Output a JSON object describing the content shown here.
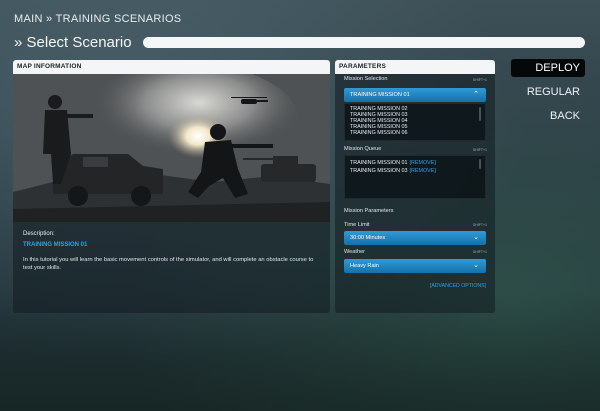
{
  "header": {
    "breadcrumb": "MAIN » TRAINING SCENARIOS",
    "title": "» Select Scenario"
  },
  "map_panel": {
    "header": "MAP INFORMATION",
    "description_label": "Description:",
    "mission_name": "TRAINING MISSION 01",
    "description_text": "In this tutorial you will learn the basic movement controls of the simulator, and will complete an obstacle course to test your skills."
  },
  "params_panel": {
    "header": "PARAMETERS",
    "mission_selection_label": "Mission Selection",
    "shift_hint": "SHIFT+1",
    "selected_mission": "TRAINING MISSION 01",
    "mission_list": [
      "TRAINING MISSION 02",
      "TRAINING MISSION 03",
      "TRAINING MISSION 04",
      "TRAINING MISSION 05",
      "TRAINING MISSION 06"
    ],
    "mission_queue_label": "Mission Queue",
    "queue": [
      {
        "name": "TRAINING MISSION 01",
        "action": "[REMOVE]"
      },
      {
        "name": "TRAINING MISSION 03",
        "action": "[REMOVE]"
      }
    ],
    "mission_parameters_label": "Mission Parameters",
    "time_limit_label": "Time Limit",
    "time_limit_value": "30:00 Minutes",
    "weather_label": "Weather",
    "weather_value": "Heavy Rain",
    "advanced_options": "[ADVANCED OPTIONS]"
  },
  "nav": {
    "deploy": "DEPLOY",
    "regular": "REGULAR",
    "back": "BACK"
  },
  "icons": {
    "dropdown_open": "chevron-up-icon",
    "dropdown_closed": "chevron-down-icon"
  },
  "colors": {
    "accent": "#2aa4e0",
    "dropdown": "#1f86c4",
    "deploy_bg": "#050809"
  }
}
